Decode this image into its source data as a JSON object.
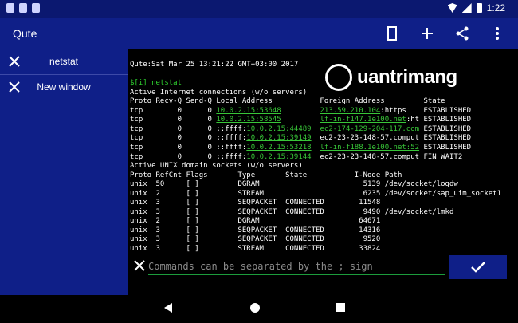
{
  "status": {
    "time": "1:22"
  },
  "app": {
    "title": "Qute"
  },
  "tabs": [
    {
      "label": "netstat"
    },
    {
      "label": "New window"
    }
  ],
  "terminal": {
    "lines": [
      [
        "Qute:Sat Mar 25 13:21:22 GMT+03:00 2017"
      ],
      [
        ""
      ],
      [
        "$[i] netstat"
      ],
      [
        "Active Internet connections (w/o servers)"
      ],
      [
        "Proto Recv-Q Send-Q Local Address           Foreign Address         State"
      ],
      [
        "tcp        0      0 ",
        "10.0.2.15:53648",
        "         ",
        "213.59.210.104",
        ":https    ESTABLISHED"
      ],
      [
        "tcp        0      0 ",
        "10.0.2.15:58545",
        "         ",
        "lf-in-f147.1e100.net",
        ":ht ESTABLISHED"
      ],
      [
        "tcp        0      0 ::ffff:",
        "10.0.2.15:44489",
        "  ",
        "ec2-174-129-204-117.com",
        " ESTABLISHED"
      ],
      [
        "tcp        0      0 ::ffff:",
        "10.0.2.15:39149",
        "  ec2-23-23-148-57.comput ESTABLISHED"
      ],
      [
        "tcp        0      0 ::ffff:",
        "10.0.2.15:53218",
        "  ",
        "lf-in-f188.1e100.net:52",
        " ESTABLISHED"
      ],
      [
        "tcp        0      0 ::ffff:",
        "10.0.2.15:39144",
        "  ec2-23-23-148-57.comput FIN_WAIT2"
      ],
      [
        "Active UNIX domain sockets (w/o servers)"
      ],
      [
        "Proto RefCnt Flags       Type       State           I-Node Path"
      ],
      [
        "unix  50     [ ]         DGRAM                        5139 /dev/socket/logdw"
      ],
      [
        "unix  2      [ ]         STREAM                       6235 /dev/socket/sap_uim_socket1"
      ],
      [
        "unix  3      [ ]         SEQPACKET  CONNECTED        11548"
      ],
      [
        "unix  3      [ ]         SEQPACKET  CONNECTED         9490 /dev/socket/lmkd"
      ],
      [
        "unix  2      [ ]         DGRAM                       64671"
      ],
      [
        "unix  3      [ ]         SEQPACKET  CONNECTED        14316"
      ],
      [
        "unix  3      [ ]         SEQPACKET  CONNECTED         9520"
      ],
      [
        "unix  3      [ ]         STREAM     CONNECTED        33824"
      ]
    ]
  },
  "watermark": {
    "text": "uantrimang"
  },
  "command": {
    "placeholder": "Commands can be separated by the ; sign"
  },
  "icons": {
    "status": [
      "sim-card-icon",
      "sd-card-icon",
      "file-icon",
      "wifi-icon",
      "signal-icon",
      "battery-icon"
    ],
    "app": [
      "script-icon",
      "add-icon",
      "share-icon",
      "more-icon"
    ],
    "close": "close-icon",
    "run": "check-icon",
    "nav": [
      "back-icon",
      "home-icon",
      "recents-icon"
    ]
  }
}
